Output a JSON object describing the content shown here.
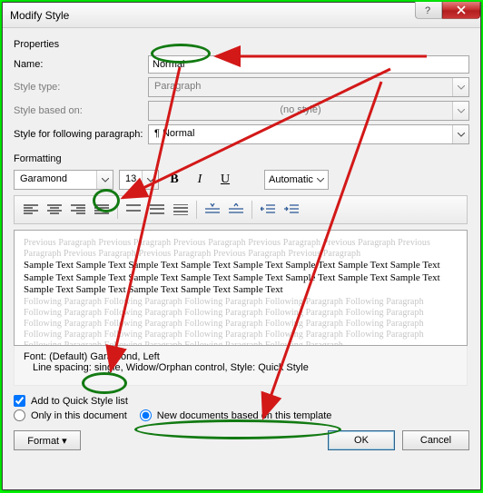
{
  "window": {
    "title": "Modify Style"
  },
  "sections": {
    "properties": "Properties",
    "formatting": "Formatting"
  },
  "labels": {
    "name": "Name:",
    "style_type": "Style type:",
    "style_based_on": "Style based on:",
    "following_para": "Style for following paragraph:"
  },
  "fields": {
    "name_value": "Normal",
    "style_type_value": "Paragraph",
    "style_based_on_value": "(no style)",
    "following_para_value": "¶ Normal"
  },
  "formatting": {
    "font": "Garamond",
    "size": "13",
    "color_label": "Automatic"
  },
  "toolbar": {
    "bold": "B",
    "italic": "I",
    "underline": "U"
  },
  "preview": {
    "ghost_prev": "Previous Paragraph Previous Paragraph Previous Paragraph Previous Paragraph Previous Paragraph Previous Paragraph Previous Paragraph Previous Paragraph Previous Paragraph Previous Paragraph",
    "sample": "Sample Text Sample Text Sample Text Sample Text Sample Text Sample Text Sample Text Sample Text Sample Text Sample Text Sample Text Sample Text Sample Text Sample Text Sample Text Sample Text Sample Text Sample Text Sample Text Sample Text Sample Text",
    "ghost_next": "Following Paragraph Following Paragraph Following Paragraph Following Paragraph Following Paragraph Following Paragraph Following Paragraph Following Paragraph Following Paragraph Following Paragraph Following Paragraph Following Paragraph Following Paragraph Following Paragraph Following Paragraph Following Paragraph Following Paragraph Following Paragraph Following Paragraph Following Paragraph Following Paragraph Following Paragraph Following Paragraph Following Paragraph"
  },
  "description": {
    "line1": "Font: (Default) Garamond, Left",
    "line2": "Line spacing:  single, Widow/Orphan control, Style: Quick Style"
  },
  "bottom": {
    "add_quick": "Add to Quick Style list",
    "only_doc": "Only in this document",
    "new_docs": "New documents based on this template"
  },
  "buttons": {
    "format": "Format ▾",
    "ok": "OK",
    "cancel": "Cancel"
  },
  "anno_color": "#127a12",
  "arrow_color": "#d31818"
}
